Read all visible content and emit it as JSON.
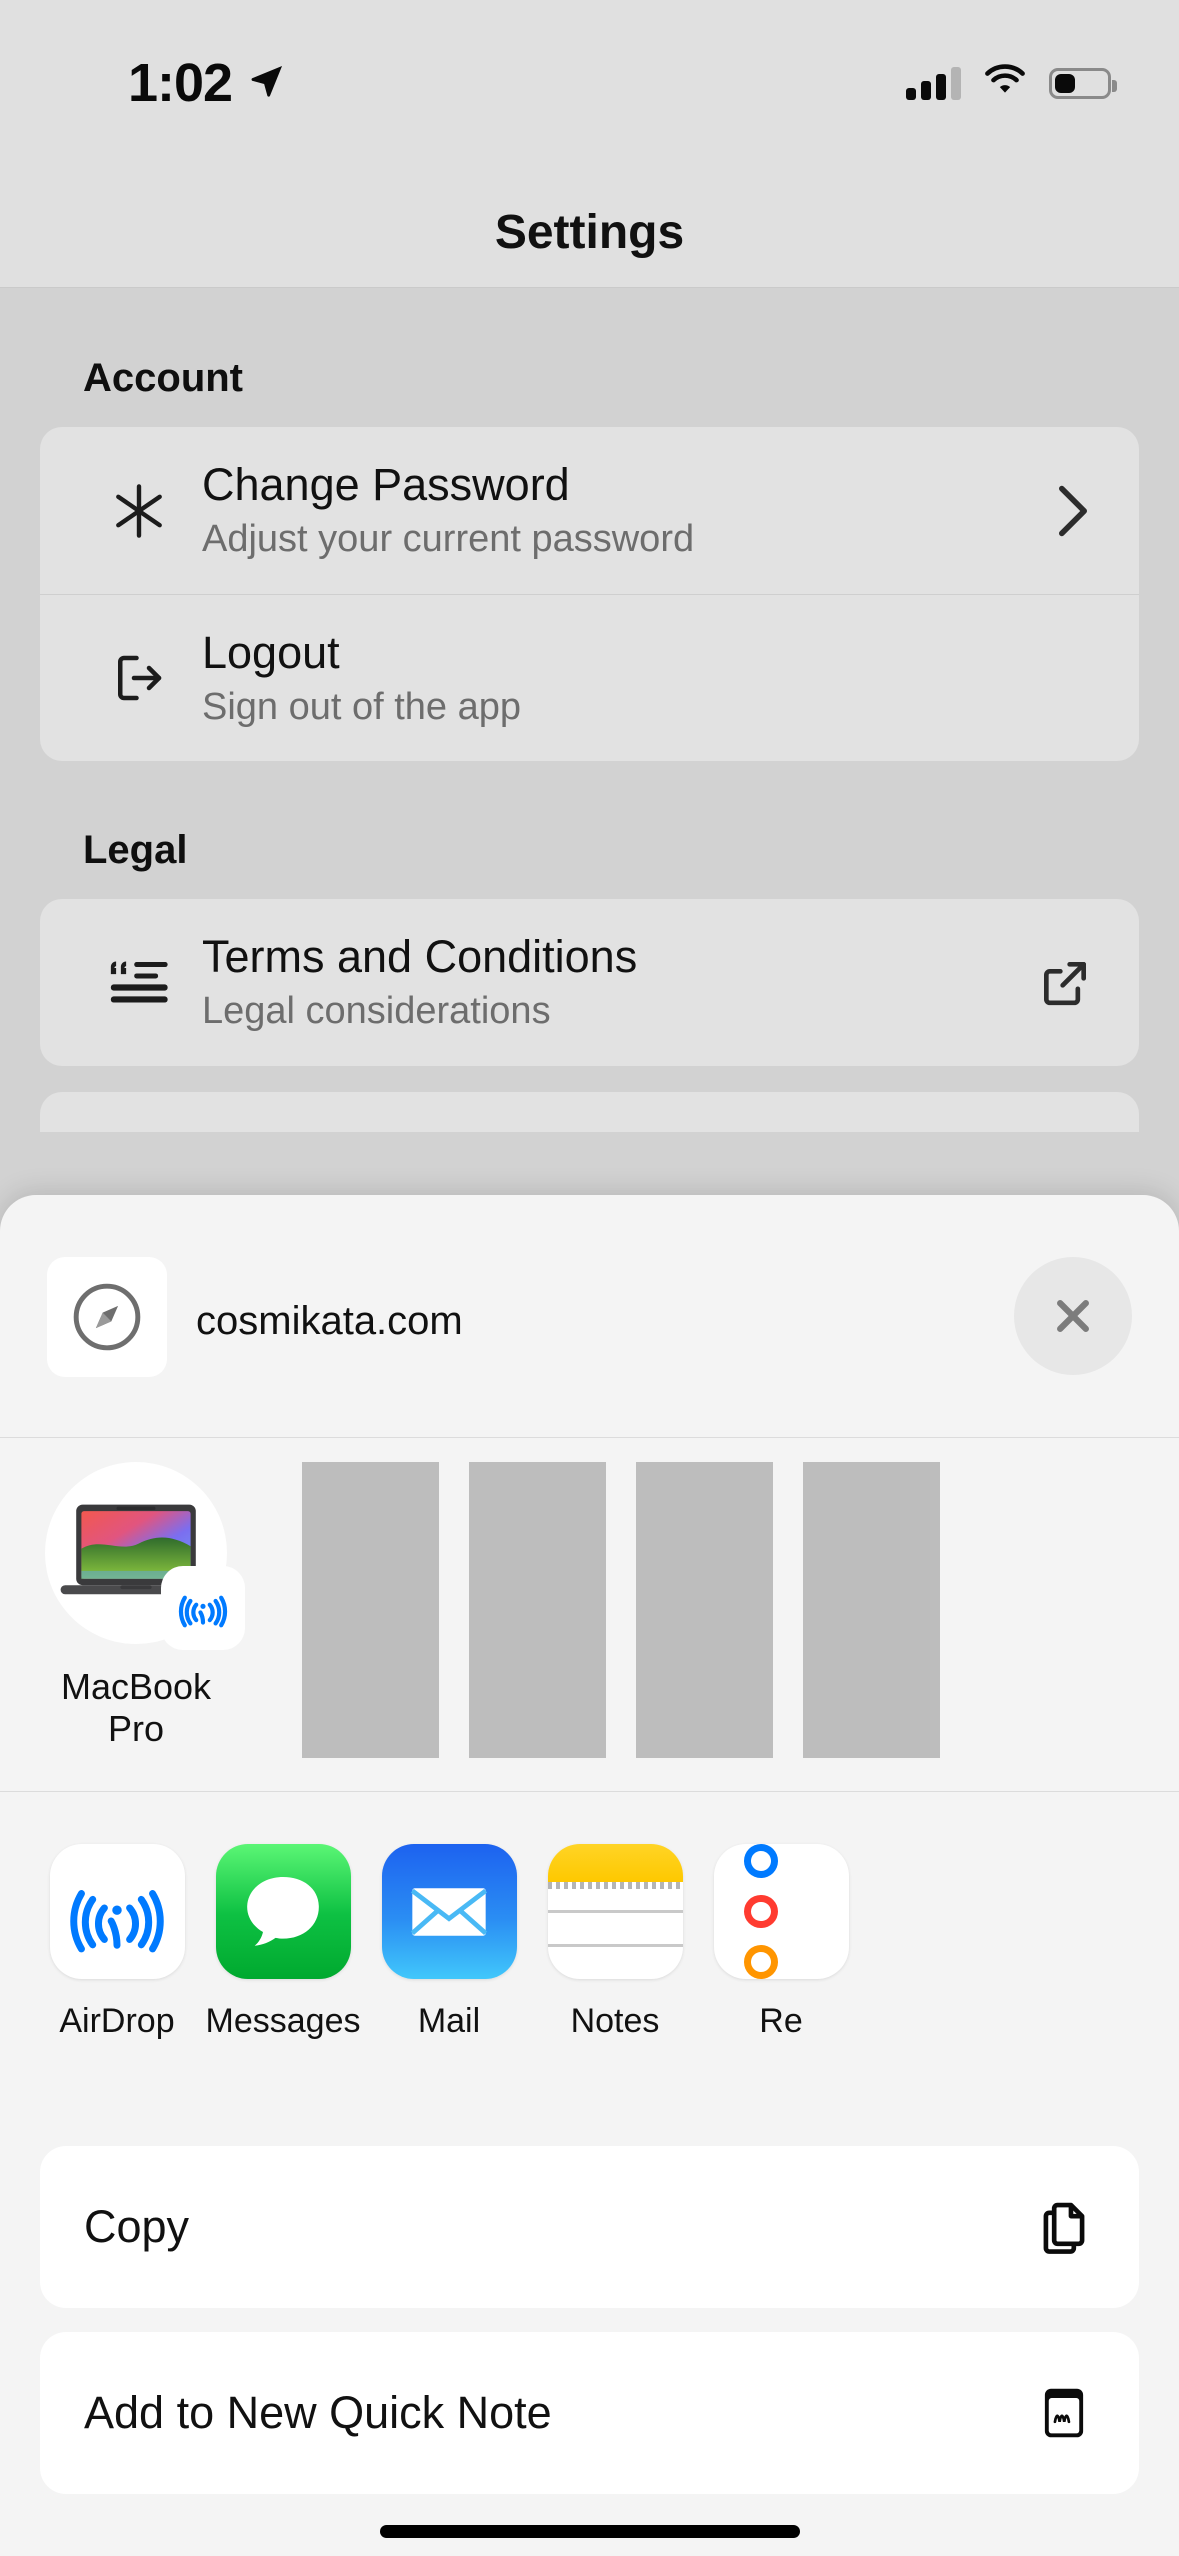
{
  "status_bar": {
    "time": "1:02",
    "location_icon": "location-arrow-icon",
    "signal_icon": "cellular-signal-icon",
    "signal_bars_filled": 3,
    "signal_bars_total": 4,
    "wifi_icon": "wifi-icon",
    "battery_icon": "battery-icon",
    "battery_level_percent": 36
  },
  "nav": {
    "title": "Settings"
  },
  "settings": {
    "sections": [
      {
        "header": "Account",
        "rows": [
          {
            "title": "Change Password",
            "subtitle": "Adjust your current password",
            "leading_icon": "asterisk-icon",
            "trailing_icon": "chevron-right-icon"
          },
          {
            "title": "Logout",
            "subtitle": "Sign out of the app",
            "leading_icon": "sign-out-icon",
            "trailing_icon": ""
          }
        ]
      },
      {
        "header": "Legal",
        "rows": [
          {
            "title": "Terms and Conditions",
            "subtitle": "Legal considerations",
            "leading_icon": "quote-list-icon",
            "trailing_icon": "external-link-icon"
          }
        ]
      }
    ]
  },
  "share_sheet": {
    "source_icon": "safari-compass-icon",
    "url": "cosmikata.com",
    "close_icon": "close-x-icon",
    "airdrop_targets": [
      {
        "label": "MacBook Pro",
        "device_icon": "macbook-pro-icon",
        "badge_icon": "airdrop-icon"
      }
    ],
    "placeholder_count": 4,
    "apps": [
      {
        "label": "AirDrop",
        "icon": "airdrop-app-icon"
      },
      {
        "label": "Messages",
        "icon": "messages-app-icon"
      },
      {
        "label": "Mail",
        "icon": "mail-app-icon"
      },
      {
        "label": "Notes",
        "icon": "notes-app-icon"
      },
      {
        "label": "Re",
        "icon": "reminders-app-icon"
      }
    ],
    "actions": [
      {
        "label": "Copy",
        "icon": "copy-icon"
      },
      {
        "label": "Add to New Quick Note",
        "icon": "quick-note-icon"
      }
    ]
  },
  "colors": {
    "screen_background": "#d2d2d2",
    "status_bar_background": "#e0e0e0",
    "card_background": "#e2e2e2",
    "sheet_background": "#f4f4f4",
    "action_card_background": "#ffffff",
    "primary_text": "#111111",
    "secondary_text": "#6d6d6d",
    "accent_blue": "#007aff",
    "messages_green": "#0ec143",
    "notes_yellow": "#ffd426"
  }
}
